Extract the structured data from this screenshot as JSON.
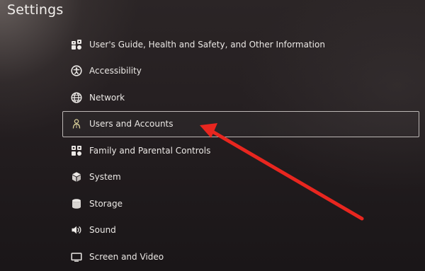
{
  "header": {
    "title": "Settings"
  },
  "menu": {
    "items": [
      {
        "label": "User's Guide, Health and Safety, and Other Information",
        "icon": "users-guide-icon"
      },
      {
        "label": "Accessibility",
        "icon": "accessibility-icon"
      },
      {
        "label": "Network",
        "icon": "network-globe-icon"
      },
      {
        "label": "Users and Accounts",
        "icon": "users-accounts-icon",
        "selected": true
      },
      {
        "label": "Family and Parental Controls",
        "icon": "family-controls-icon"
      },
      {
        "label": "System",
        "icon": "system-cube-icon"
      },
      {
        "label": "Storage",
        "icon": "storage-cylinder-icon"
      },
      {
        "label": "Sound",
        "icon": "speaker-icon"
      },
      {
        "label": "Screen and Video",
        "icon": "screen-icon"
      }
    ]
  },
  "annotation": {
    "color": "#e8261f",
    "points_to": "Users and Accounts"
  },
  "colors": {
    "text": "#ebe8e5",
    "selection_border": "#bdb8b6",
    "background": "#231e20"
  }
}
